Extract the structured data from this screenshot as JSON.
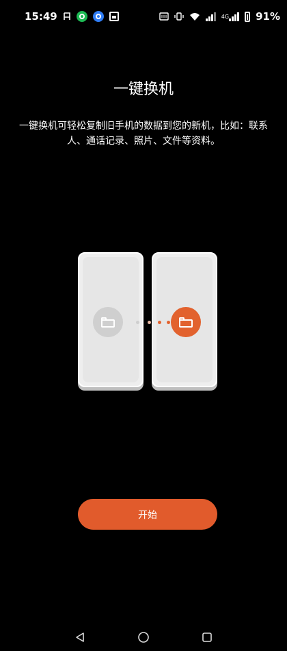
{
  "status_bar": {
    "time": "15:49",
    "battery_percent": "91%",
    "network_label": "4G",
    "left_icons": [
      "notification-icon",
      "green-app-icon",
      "blue-app-icon",
      "gallery-icon"
    ],
    "right_icons": [
      "nfc-icon",
      "vibrate-icon",
      "wifi-icon",
      "signal-icon",
      "signal-4g-icon",
      "battery-icon"
    ]
  },
  "page": {
    "title": "一键换机",
    "description": "一键换机可轻松复制旧手机的数据到您的新机，比如：联系人、通话记录、照片、文件等资料。"
  },
  "illustration": {
    "old_phone_folder_color": "#cfcfcf",
    "new_phone_folder_color": "#e2622e",
    "dot_colors": [
      "#cfcfcf",
      "#e8b9a5",
      "#e2622e"
    ]
  },
  "actions": {
    "start_label": "开始",
    "accent_color": "#e15b2c"
  },
  "nav_bar": {
    "icons": [
      "back-icon",
      "home-icon",
      "recents-icon"
    ]
  }
}
